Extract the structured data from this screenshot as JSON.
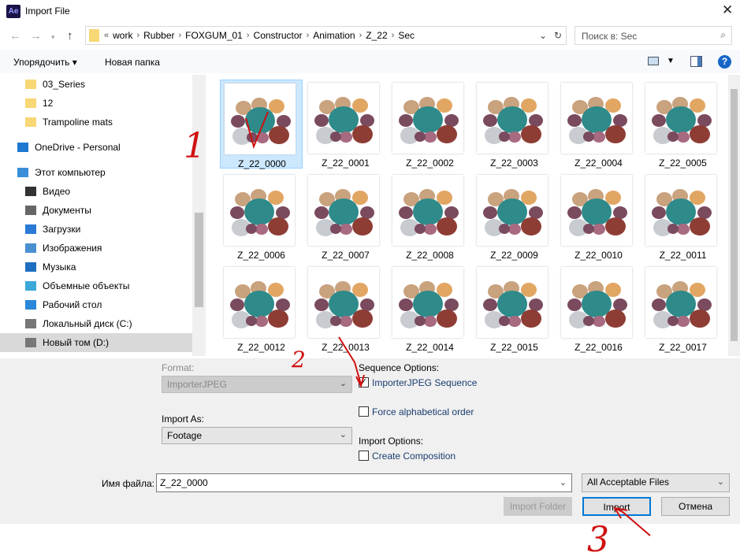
{
  "window": {
    "title": "Import File",
    "app_icon": "Ae"
  },
  "address": {
    "prefix": "«",
    "crumbs": [
      "work",
      "Rubber",
      "FOXGUM_01",
      "Constructor",
      "Animation",
      "Z_22",
      "Sec"
    ]
  },
  "search": {
    "placeholder": "Поиск в: Sec"
  },
  "toolbar": {
    "organize": "Упорядочить ▾",
    "new_folder": "Новая папка"
  },
  "nav": [
    {
      "label": "03_Series",
      "icon": "folder-icon"
    },
    {
      "label": "12",
      "icon": "folder-icon"
    },
    {
      "label": "Trampoline mats",
      "icon": "folder-icon"
    },
    {
      "label": "OneDrive - Personal",
      "icon": "cloud-icon"
    },
    {
      "label": "Этот компьютер",
      "icon": "computer-icon"
    },
    {
      "label": "Видео",
      "icon": "video-icon"
    },
    {
      "label": "Документы",
      "icon": "document-icon"
    },
    {
      "label": "Загрузки",
      "icon": "download-icon"
    },
    {
      "label": "Изображения",
      "icon": "image-icon"
    },
    {
      "label": "Музыка",
      "icon": "music-icon"
    },
    {
      "label": "Объемные объекты",
      "icon": "3d-icon"
    },
    {
      "label": "Рабочий стол",
      "icon": "desktop-icon"
    },
    {
      "label": "Локальный диск (C:)",
      "icon": "drive-icon"
    },
    {
      "label": "Новый том (D:)",
      "icon": "drive-icon"
    }
  ],
  "files": [
    "Z_22_0000",
    "Z_22_0001",
    "Z_22_0002",
    "Z_22_0003",
    "Z_22_0004",
    "Z_22_0005",
    "Z_22_0006",
    "Z_22_0007",
    "Z_22_0008",
    "Z_22_0009",
    "Z_22_0010",
    "Z_22_0011",
    "Z_22_0012",
    "Z_22_0013",
    "Z_22_0014",
    "Z_22_0015",
    "Z_22_0016",
    "Z_22_0017"
  ],
  "options": {
    "format_label": "Format:",
    "format_value": "ImporterJPEG",
    "import_as_label": "Import As:",
    "import_as_value": "Footage",
    "sequence_label": "Sequence Options:",
    "sequence_cb": "ImporterJPEG Sequence",
    "sequence_checked": true,
    "force_cb": "Force alphabetical order",
    "force_checked": false,
    "import_options_label": "Import Options:",
    "create_comp_cb": "Create Composition",
    "create_comp_checked": false
  },
  "filename": {
    "label": "Имя файла:",
    "value": "Z_22_0000",
    "filter": "All Acceptable Files"
  },
  "buttons": {
    "import_folder": "Import Folder",
    "import": "Import",
    "cancel": "Отмена"
  },
  "annotations": [
    "1",
    "2",
    "3"
  ]
}
